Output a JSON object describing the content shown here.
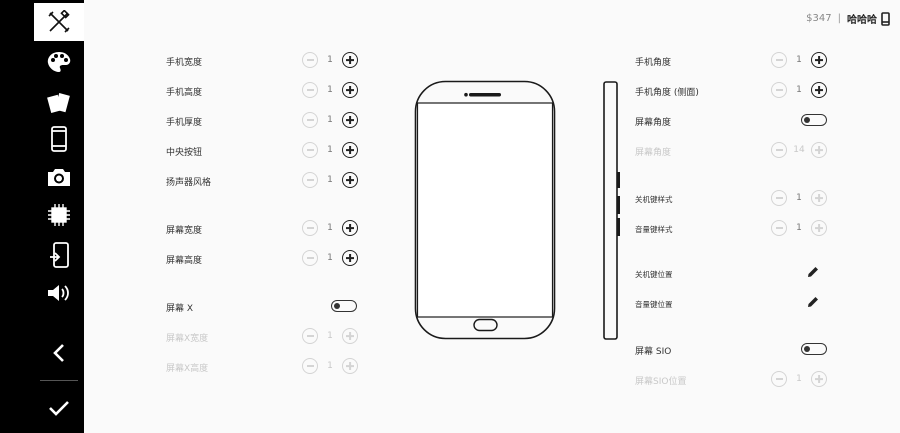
{
  "status": {
    "coins": "$347",
    "separator": "|",
    "user": "哈哈哈"
  },
  "sidebar": {
    "items": [
      {
        "icon": "tools-icon",
        "active": true
      },
      {
        "icon": "palette-icon"
      },
      {
        "icon": "cards-icon"
      },
      {
        "icon": "phone-icon"
      },
      {
        "icon": "camera-icon"
      },
      {
        "icon": "chip-icon"
      },
      {
        "icon": "phone-rotate-icon"
      },
      {
        "icon": "speaker-icon"
      },
      {
        "icon": "back-chevron-icon"
      },
      {
        "icon": "checkmark-icon"
      }
    ]
  },
  "left_controls": [
    {
      "label": "手机宽度",
      "value": "1",
      "enabled": true
    },
    {
      "label": "手机高度",
      "value": "1",
      "enabled": true
    },
    {
      "label": "手机厚度",
      "value": "1",
      "enabled": true
    },
    {
      "label": "中央按钮",
      "value": "1",
      "enabled": true
    },
    {
      "label": "扬声器风格",
      "value": "1",
      "enabled": true
    },
    {
      "label": "屏幕宽度",
      "value": "1",
      "enabled": true
    },
    {
      "label": "屏幕高度",
      "value": "1",
      "enabled": true
    },
    {
      "label": "屏幕 X",
      "toggle": false
    },
    {
      "label": "屏幕X宽度",
      "value": "1",
      "enabled": false
    },
    {
      "label": "屏幕X高度",
      "value": "1",
      "enabled": false
    }
  ],
  "right_controls": [
    {
      "label": "手机角度",
      "value": "1",
      "enabled": true
    },
    {
      "label": "手机角度 (侧面)",
      "value": "1",
      "enabled": true
    },
    {
      "label": "屏幕角度",
      "toggle": false
    },
    {
      "label": "屏幕角度",
      "value": "14",
      "enabled": false
    },
    {
      "label": "关机键样式",
      "value": "1",
      "enabled": false
    },
    {
      "label": "音量键样式",
      "value": "1",
      "enabled": false
    },
    {
      "label": "关机键位置"
    },
    {
      "label": "音量键位置"
    },
    {
      "label": "屏幕 SIO",
      "toggle": false
    },
    {
      "label": "屏幕SIO位置",
      "value": "1",
      "enabled": false
    }
  ],
  "colors": {
    "sidebar_bg": "#000000",
    "main_bg": "#fafafa",
    "active_item_bg": "#ffffff",
    "accent": "#222222",
    "disabled": "#c8c8c8"
  }
}
